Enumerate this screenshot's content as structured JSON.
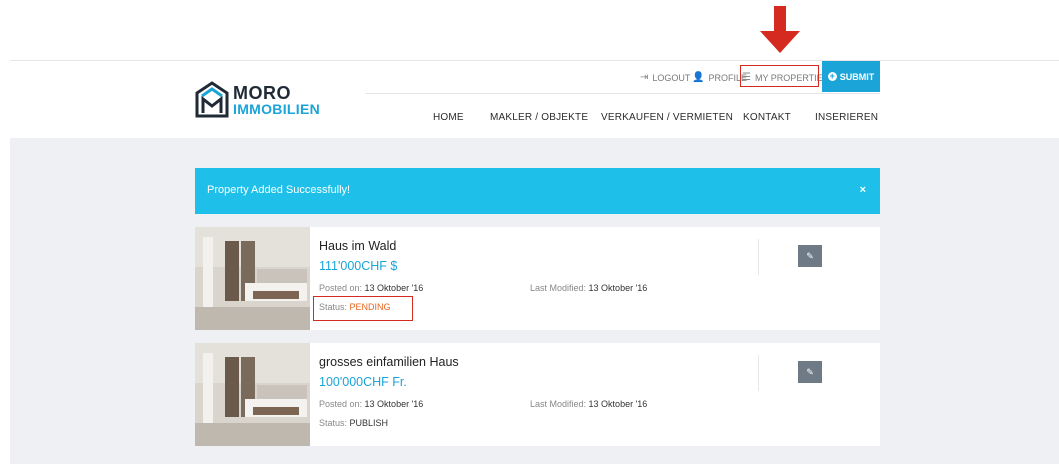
{
  "logo": {
    "line1": "MORO",
    "line2": "IMMOBILIEN"
  },
  "utility": {
    "logout": "LOGOUT",
    "profile": "PROFILE",
    "my_properties": "MY PROPERTIES",
    "submit": "SUBMIT"
  },
  "nav": {
    "items": [
      "HOME",
      "MAKLER / OBJEKTE",
      "VERKAUFEN / VERMIETEN",
      "KONTAKT",
      "INSERIEREN"
    ]
  },
  "alert": {
    "text": "Property Added Successfully!",
    "close": "×"
  },
  "labels": {
    "posted_on": "Posted on:",
    "last_modified": "Last Modified:",
    "status": "Status:"
  },
  "properties": [
    {
      "title": "Haus im Wald",
      "price": "111'000CHF $",
      "posted": "13 Oktober '16",
      "modified": "13 Oktober '16",
      "status": "PENDING"
    },
    {
      "title": "grosses einfamilien Haus",
      "price": "100'000CHF Fr.",
      "posted": "13 Oktober '16",
      "modified": "13 Oktober '16",
      "status": "PUBLISH"
    }
  ],
  "colors": {
    "accent": "#1aa4d8",
    "alert": "#1ec0ea",
    "annotation": "#d42a20",
    "pending": "#e8651f"
  }
}
